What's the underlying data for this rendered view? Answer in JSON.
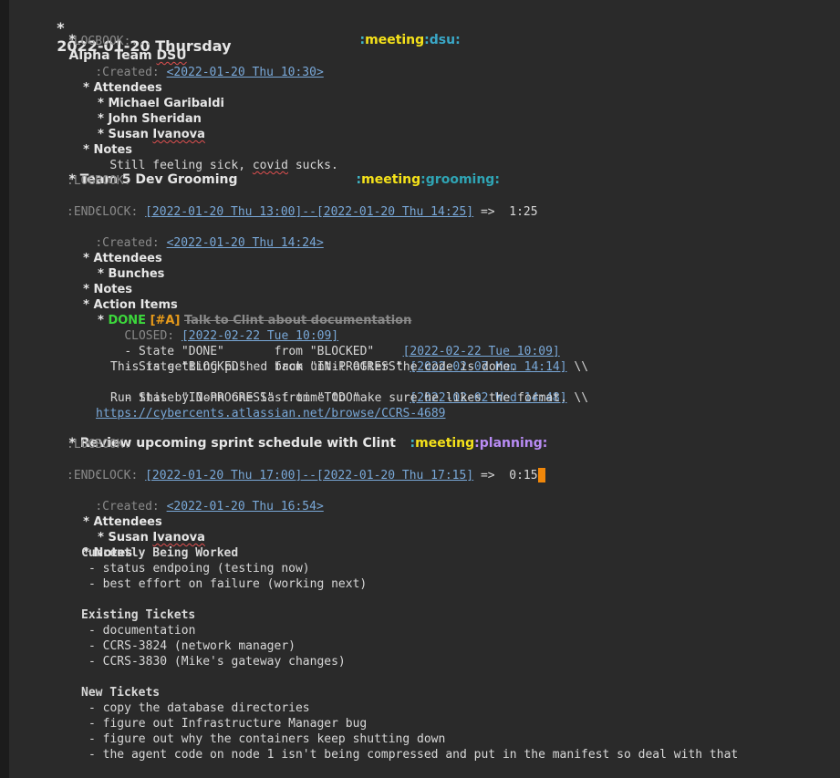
{
  "day": {
    "star": "*",
    "title": "2022-01-20 Thursday"
  },
  "alpha": {
    "star": "*",
    "title_a": "Alpha Team ",
    "title_b": "DSU",
    "tag_meeting": "meeting",
    "tag_dsu": "dsu",
    "logbook": ":LOGBOOK:...",
    "created_label": ":Created: ",
    "created_ts": "<2022-01-20 Thu 10:30>",
    "attendees_star": "*",
    "attendees": "Attendees",
    "people": [
      {
        "star": "*",
        "first": "Michael Garibaldi",
        "last": ""
      },
      {
        "star": "*",
        "first": "John Sheridan",
        "last": ""
      },
      {
        "star": "*",
        "first": "Susan ",
        "last": "Ivanova"
      }
    ],
    "notes_star": "*",
    "notes": "Notes",
    "notes_text_a": "Still feeling sick, ",
    "notes_text_b": "covid",
    "notes_text_c": " sucks."
  },
  "team5": {
    "star": "*",
    "title": "Team 5 Dev Grooming",
    "tag_meeting": "meeting",
    "tag_grooming": "grooming",
    "logbook": ":LOGBOOK:",
    "clock_label": "CLOCK: ",
    "clock_range": "[2022-01-20 Thu 13:00]--[2022-01-20 Thu 14:25]",
    "clock_tail": " =>  1:25",
    "end": ":END:",
    "created_label": ":Created: ",
    "created_ts": "<2022-01-20 Thu 14:24>",
    "attendees_star": "*",
    "attendees": "Attendees",
    "bunches_star": "*",
    "bunches": "Bunches",
    "notes_star": "*",
    "notes": "Notes",
    "actions_star": "*",
    "actions": "Action Items",
    "todo_star": "*",
    "todo_state": "DONE",
    "todo_prio": "[#A]",
    "todo_title": "Talk to Clint about documentation",
    "closed_label": "CLOSED: ",
    "closed_ts": "[2022-02-22 Tue 10:09]",
    "state1_text": "- State \"DONE\"       from \"BLOCKED\"    ",
    "state1_ts": "[2022-02-22 Tue 10:09]",
    "state2_text": "- State \"BLOCKED\"    from \"IN-PROGRESS\" ",
    "state2_ts": "[2022-02-07 Mon 14:14]",
    "state2_tail": " \\\\",
    "state2_note": "This is getting pushed back until after the code is done.",
    "state3_text": "- State \"IN-PROGRESS\" from \"TODO\"       ",
    "state3_ts": "[2022-02-02 Wed 14:48]",
    "state3_tail": " \\\\",
    "state3_note": "Run this by John one last time to make sure he likes the format.",
    "url": "https://cybercents.atlassian.net/browse/CCRS-4689"
  },
  "review": {
    "star": "*",
    "title": "Review upcoming sprint schedule with Clint",
    "tag_meeting": "meeting",
    "tag_planning": "planning",
    "logbook": ":LOGBOOK:",
    "clock_label": "CLOCK: ",
    "clock_range": "[2022-01-20 Thu 17:00]--[2022-01-20 Thu 17:15]",
    "clock_tail": " =>  0:15",
    "end": ":END:",
    "created_label": ":Created: ",
    "created_ts": "<2022-01-20 Thu 16:54>",
    "attendees_star": "*",
    "attendees": "Attendees",
    "person_star": "*",
    "person_first": "Susan ",
    "person_last": "Ivanova",
    "notes_star": "*",
    "notes": "Notes",
    "sections": {
      "worked_title": "Currently Being Worked",
      "worked": [
        "- status endpoing (testing now)",
        "- best effort on failure (working next)"
      ],
      "existing_title": "Existing Tickets",
      "existing": [
        "- documentation",
        "- CCRS-3824 (network manager)",
        "- CCRS-3830 (Mike's gateway changes)"
      ],
      "new_title": "New Tickets",
      "new": [
        "- copy the database directories",
        "- figure out Infrastructure Manager bug",
        "- figure out why the containers keep shutting down",
        "- the agent code on node 1 isn't being compressed and put in the manifest so deal with that"
      ]
    }
  },
  "colors": {
    "background": "#2a2a2a",
    "tag_meeting": "#f5e21a",
    "tag_dsu": "#3aa8c8",
    "tag_grooming": "#2fa4b4",
    "tag_planning": "#b98cf5",
    "done": "#3cd83c",
    "priority": "#e89b1a",
    "link": "#79a8d8",
    "cursor": "#f0870a"
  }
}
